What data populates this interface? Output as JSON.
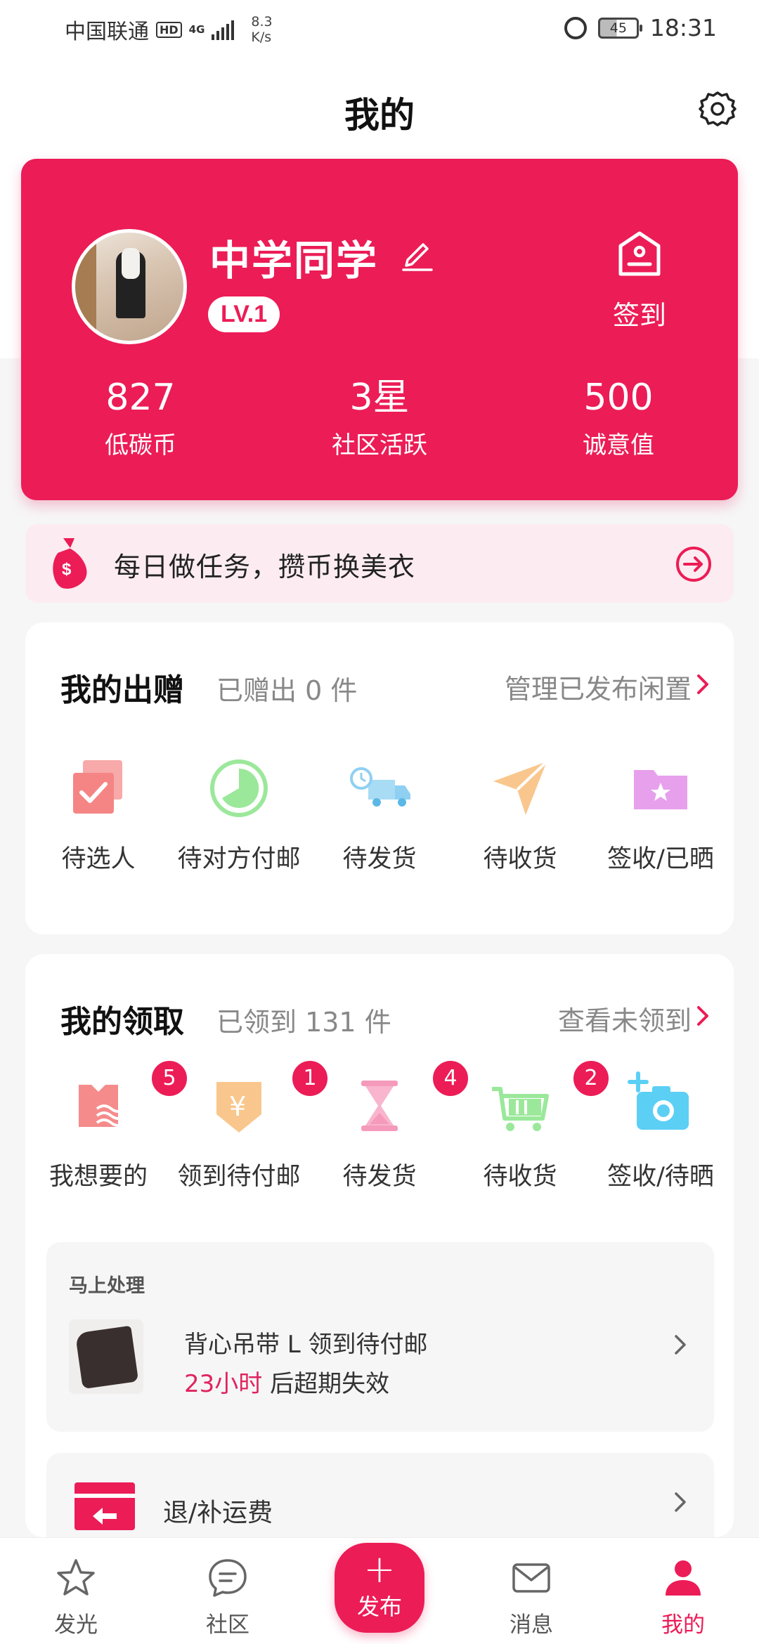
{
  "status_bar": {
    "carrier": "中国联通",
    "hd": "HD",
    "network": "4G",
    "speed_value": "8.3",
    "speed_unit": "K/s",
    "battery": "45",
    "time": "18:31"
  },
  "header": {
    "title": "我的"
  },
  "profile": {
    "nickname": "中学同学",
    "level": "LV.1",
    "checkin_label": "签到",
    "stats": [
      {
        "value": "827",
        "label": "低碳币"
      },
      {
        "value": "3星",
        "label": "社区活跃"
      },
      {
        "value": "500",
        "label": "诚意值"
      }
    ]
  },
  "task_banner": {
    "text": "每日做任务，攒币换美衣"
  },
  "give": {
    "title": "我的出赠",
    "subtitle": "已赠出 0 件",
    "link": "管理已发布闲置",
    "items": [
      {
        "label": "待选人",
        "icon": "select-person-icon",
        "color": "#f58b8b"
      },
      {
        "label": "待对方付邮",
        "icon": "clock-circle-icon",
        "color": "#9be89b"
      },
      {
        "label": "待发货",
        "icon": "delivery-truck-icon",
        "color": "#8fd0f2"
      },
      {
        "label": "待收货",
        "icon": "paper-plane-icon",
        "color": "#f9c78d"
      },
      {
        "label": "签收/已晒",
        "icon": "star-folder-icon",
        "color": "#e7a0ec"
      }
    ]
  },
  "receive": {
    "title": "我的领取",
    "subtitle": "已领到 131 件",
    "link": "查看未领到",
    "items": [
      {
        "label": "我想要的",
        "icon": "shirt-wish-icon",
        "badge": "5",
        "color": "#f58b8b"
      },
      {
        "label": "领到待付邮",
        "icon": "yen-shield-icon",
        "badge": "1",
        "color": "#f9c78d"
      },
      {
        "label": "待发货",
        "icon": "hourglass-icon",
        "badge": "4",
        "color": "#f59abb"
      },
      {
        "label": "待收货",
        "icon": "shopping-cart-icon",
        "badge": "2",
        "color": "#9be89b"
      },
      {
        "label": "签收/待晒",
        "icon": "add-camera-icon",
        "badge": "",
        "color": "#5ccff5"
      }
    ],
    "process": {
      "title": "马上处理",
      "item_name": "背心吊带 L 领到待付邮",
      "deadline_highlight": "23小时",
      "deadline_rest": " 后超期失效"
    },
    "refund": {
      "label": "退/补运费"
    }
  },
  "bottom_nav": [
    {
      "label": "发光",
      "icon": "star-icon"
    },
    {
      "label": "社区",
      "icon": "chat-bubble-icon"
    },
    {
      "label": "发布",
      "icon": "plus-icon"
    },
    {
      "label": "消息",
      "icon": "mail-icon"
    },
    {
      "label": "我的",
      "icon": "user-icon"
    }
  ],
  "colors": {
    "brand": "#ec1c56",
    "banner_bg": "#fcecf1",
    "page_bg": "#f6f6f7"
  }
}
